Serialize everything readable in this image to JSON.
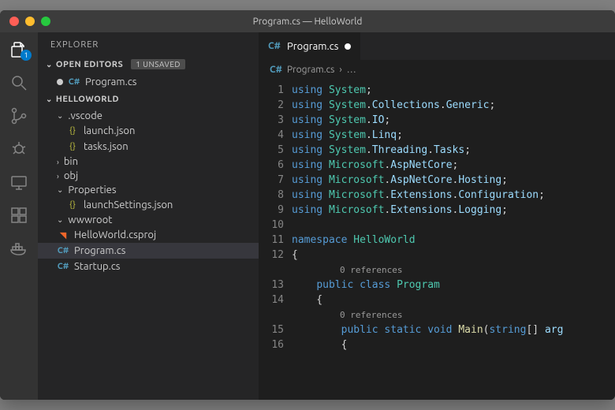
{
  "window": {
    "title": "Program.cs — HelloWorld"
  },
  "activitybar": {
    "explorer_badge": "1"
  },
  "sidebar": {
    "title": "EXPLORER",
    "open_editors_label": "OPEN EDITORS",
    "unsaved_label": "1 UNSAVED",
    "open_editors": [
      {
        "name": "Program.cs",
        "icon": "csharp",
        "dirty": true
      }
    ],
    "workspace_label": "HELLOWORLD",
    "tree": [
      {
        "name": ".vscode",
        "type": "folder",
        "open": true
      },
      {
        "name": "launch.json",
        "type": "json",
        "depth": 1
      },
      {
        "name": "tasks.json",
        "type": "json",
        "depth": 1
      },
      {
        "name": "bin",
        "type": "folder",
        "open": false
      },
      {
        "name": "obj",
        "type": "folder",
        "open": false
      },
      {
        "name": "Properties",
        "type": "folder",
        "open": true
      },
      {
        "name": "launchSettings.json",
        "type": "json",
        "depth": 1
      },
      {
        "name": "wwwroot",
        "type": "folder",
        "open": true
      },
      {
        "name": "HelloWorld.csproj",
        "type": "rss"
      },
      {
        "name": "Program.cs",
        "type": "csharp",
        "selected": true
      },
      {
        "name": "Startup.cs",
        "type": "csharp"
      }
    ]
  },
  "editor": {
    "tab": {
      "name": "Program.cs",
      "dirty": true
    },
    "breadcrumb": {
      "file": "Program.cs",
      "sep": "›",
      "more": "…"
    },
    "codelens": "0 references",
    "code": [
      {
        "n": 1,
        "tokens": [
          [
            "kw",
            "using "
          ],
          [
            "ns",
            "System"
          ],
          [
            "punc",
            ";"
          ]
        ]
      },
      {
        "n": 2,
        "tokens": [
          [
            "kw",
            "using "
          ],
          [
            "ns",
            "System"
          ],
          [
            "punc",
            "."
          ],
          [
            "mem",
            "Collections"
          ],
          [
            "punc",
            "."
          ],
          [
            "mem",
            "Generic"
          ],
          [
            "punc",
            ";"
          ]
        ]
      },
      {
        "n": 3,
        "tokens": [
          [
            "kw",
            "using "
          ],
          [
            "ns",
            "System"
          ],
          [
            "punc",
            "."
          ],
          [
            "mem",
            "IO"
          ],
          [
            "punc",
            ";"
          ]
        ]
      },
      {
        "n": 4,
        "tokens": [
          [
            "kw",
            "using "
          ],
          [
            "ns",
            "System"
          ],
          [
            "punc",
            "."
          ],
          [
            "mem",
            "Linq"
          ],
          [
            "punc",
            ";"
          ]
        ]
      },
      {
        "n": 5,
        "tokens": [
          [
            "kw",
            "using "
          ],
          [
            "ns",
            "System"
          ],
          [
            "punc",
            "."
          ],
          [
            "mem",
            "Threading"
          ],
          [
            "punc",
            "."
          ],
          [
            "mem",
            "Tasks"
          ],
          [
            "punc",
            ";"
          ]
        ]
      },
      {
        "n": 6,
        "tokens": [
          [
            "kw",
            "using "
          ],
          [
            "ns",
            "Microsoft"
          ],
          [
            "punc",
            "."
          ],
          [
            "mem",
            "AspNetCore"
          ],
          [
            "punc",
            ";"
          ]
        ]
      },
      {
        "n": 7,
        "tokens": [
          [
            "kw",
            "using "
          ],
          [
            "ns",
            "Microsoft"
          ],
          [
            "punc",
            "."
          ],
          [
            "mem",
            "AspNetCore"
          ],
          [
            "punc",
            "."
          ],
          [
            "mem",
            "Hosting"
          ],
          [
            "punc",
            ";"
          ]
        ]
      },
      {
        "n": 8,
        "tokens": [
          [
            "kw",
            "using "
          ],
          [
            "ns",
            "Microsoft"
          ],
          [
            "punc",
            "."
          ],
          [
            "mem",
            "Extensions"
          ],
          [
            "punc",
            "."
          ],
          [
            "mem",
            "Configuration"
          ],
          [
            "punc",
            ";"
          ]
        ]
      },
      {
        "n": 9,
        "tokens": [
          [
            "kw",
            "using "
          ],
          [
            "ns",
            "Microsoft"
          ],
          [
            "punc",
            "."
          ],
          [
            "mem",
            "Extensions"
          ],
          [
            "punc",
            "."
          ],
          [
            "mem",
            "Logging"
          ],
          [
            "punc",
            ";"
          ]
        ]
      },
      {
        "n": 10,
        "tokens": []
      },
      {
        "n": 11,
        "tokens": [
          [
            "kw",
            "namespace "
          ],
          [
            "ns",
            "HelloWorld"
          ]
        ]
      },
      {
        "n": 12,
        "tokens": [
          [
            "punc",
            "{"
          ]
        ]
      },
      {
        "n": 13,
        "codelens": true,
        "tokens": [
          [
            "punc",
            "    "
          ],
          [
            "kw",
            "public class "
          ],
          [
            "ns",
            "Program"
          ]
        ]
      },
      {
        "n": 14,
        "tokens": [
          [
            "punc",
            "    {"
          ]
        ]
      },
      {
        "n": 15,
        "codelens": true,
        "tokens": [
          [
            "punc",
            "        "
          ],
          [
            "kw",
            "public static void "
          ],
          [
            "fn",
            "Main"
          ],
          [
            "punc",
            "("
          ],
          [
            "kw",
            "string"
          ],
          [
            "punc",
            "[] "
          ],
          [
            "mem",
            "arg"
          ]
        ]
      },
      {
        "n": 16,
        "tokens": [
          [
            "punc",
            "        {"
          ]
        ]
      }
    ]
  }
}
